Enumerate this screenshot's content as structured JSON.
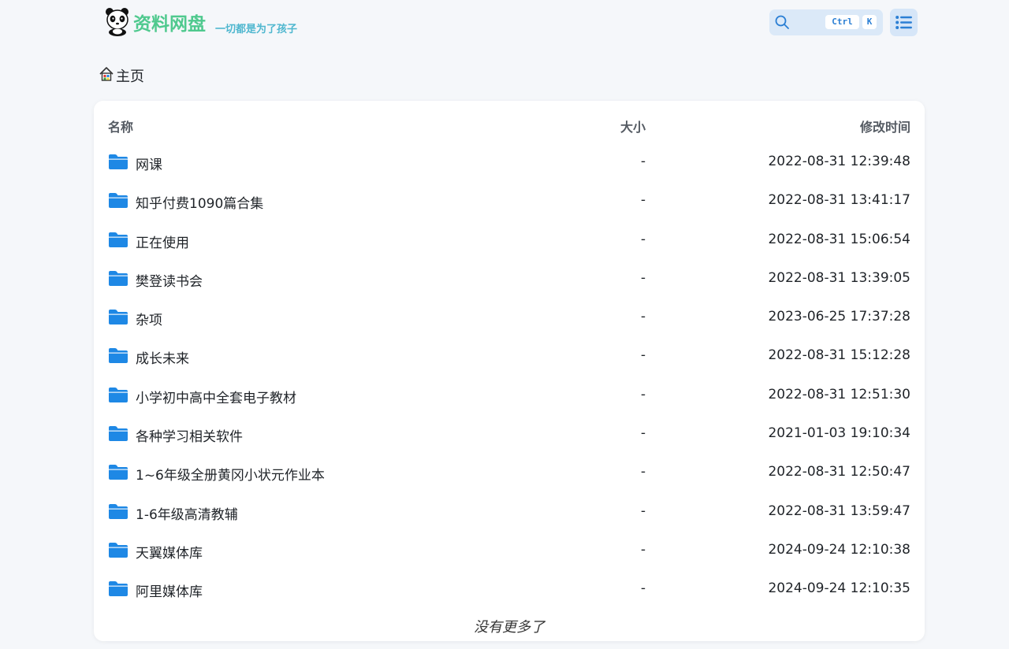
{
  "header": {
    "logo_name": "资料网盘",
    "slogan": "一切都是为了孩子",
    "search_shortcut_ctrl": "Ctrl",
    "search_shortcut_key": "K"
  },
  "breadcrumb": {
    "home_label": "主页"
  },
  "table": {
    "columns": {
      "name": "名称",
      "size": "大小",
      "modified": "修改时间"
    },
    "rows": [
      {
        "name": "网课",
        "size": "-",
        "modified": "2022-08-31 12:39:48"
      },
      {
        "name": "知乎付费1090篇合集",
        "size": "-",
        "modified": "2022-08-31 13:41:17"
      },
      {
        "name": "正在使用",
        "size": "-",
        "modified": "2022-08-31 15:06:54"
      },
      {
        "name": "樊登读书会",
        "size": "-",
        "modified": "2022-08-31 13:39:05"
      },
      {
        "name": "杂项",
        "size": "-",
        "modified": "2023-06-25 17:37:28"
      },
      {
        "name": "成长未来",
        "size": "-",
        "modified": "2022-08-31 15:12:28"
      },
      {
        "name": "小学初中高中全套电子教材",
        "size": "-",
        "modified": "2022-08-31 12:51:30"
      },
      {
        "name": "各种学习相关软件",
        "size": "-",
        "modified": "2021-01-03 19:10:34"
      },
      {
        "name": "1~6年级全册黄冈小状元作业本",
        "size": "-",
        "modified": "2022-08-31 12:50:47"
      },
      {
        "name": "1-6年级高清教辅",
        "size": "-",
        "modified": "2022-08-31 13:59:47"
      },
      {
        "name": "天翼媒体库",
        "size": "-",
        "modified": "2024-09-24 12:10:38"
      },
      {
        "name": "阿里媒体库",
        "size": "-",
        "modified": "2024-09-24 12:10:35"
      }
    ],
    "footer_note": "没有更多了"
  },
  "icons": {
    "logo": "panda-icon",
    "search": "search-icon",
    "menu": "list-menu-icon",
    "home": "home-icon",
    "folder": "folder-icon"
  },
  "colors": {
    "accent": "#1e88e5",
    "logo_green": "#4fc98e",
    "slogan_teal": "#4fb7cf",
    "search_bg": "#dbe9f8"
  }
}
